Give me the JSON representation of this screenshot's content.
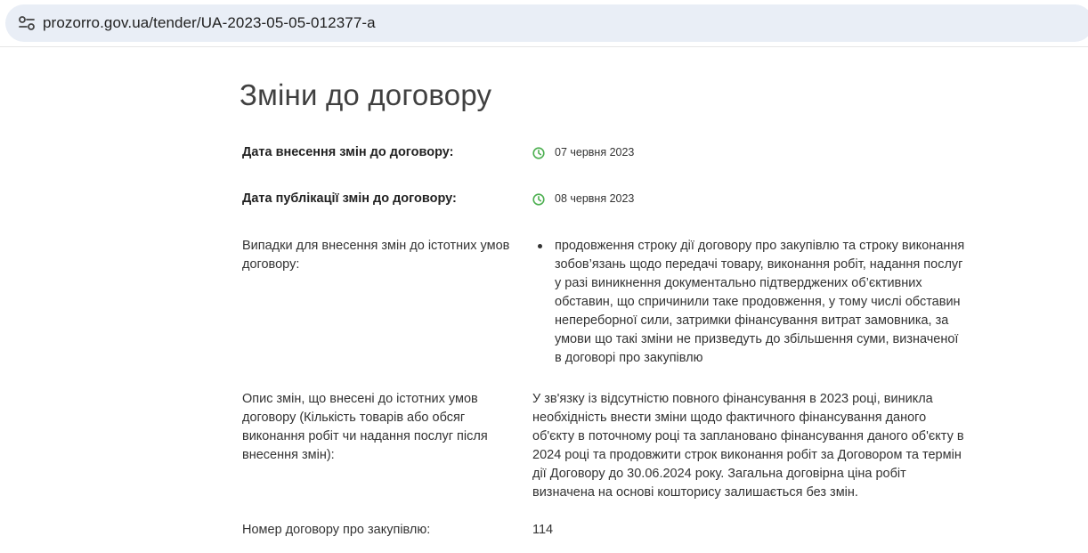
{
  "browser": {
    "url": "prozorro.gov.ua/tender/UA-2023-05-05-012377-a",
    "site_info_icon": "tune-settings-icon"
  },
  "page": {
    "title": "Зміни до договору"
  },
  "rows": {
    "change_date": {
      "label": "Дата внесення змін до договору:",
      "value": "07 червня 2023",
      "icon": "clock-icon"
    },
    "publish_date": {
      "label": "Дата публікації змін до договору:",
      "value": "08 червня 2023",
      "icon": "clock-icon"
    },
    "cases": {
      "label": "Випадки для внесення змін до істотних умов договору:",
      "items": [
        "продовження строку дії договору про закупівлю та строку виконання зобов’язань щодо передачі товару, виконання робіт, надання послуг у разі виникнення документально підтверджених об’єктивних обставин, що спричинили таке продовження, у тому числі обставин непереборної сили, затримки фінансування витрат замовника, за умови що такі зміни не призведуть до збільшення суми, визначеної в договорі про закупівлю"
      ]
    },
    "description": {
      "label": "Опис змін, що внесені до істотних умов договору (Кількість товарів або обсяг виконання робіт чи надання послуг після внесення змін):",
      "value": "У зв'язку із відсутністю повного фінансування в 2023 році, виникла необхідність внести зміни щодо фактичного фінансування даного об'єкту в поточному році та заплановано фінансування даного об'єкту в 2024 році та продовжити строк виконання робіт за Договором та термін дії Договору до 30.06.2024 року. Загальна договірна ціна робіт визначена на основі кошторису залишається без змін."
    },
    "contract_number": {
      "label": "Номер договору про закупівлю:",
      "value": "114"
    }
  },
  "colors": {
    "clock_icon": "#4caf50",
    "address_bar": "#e9eef6"
  }
}
